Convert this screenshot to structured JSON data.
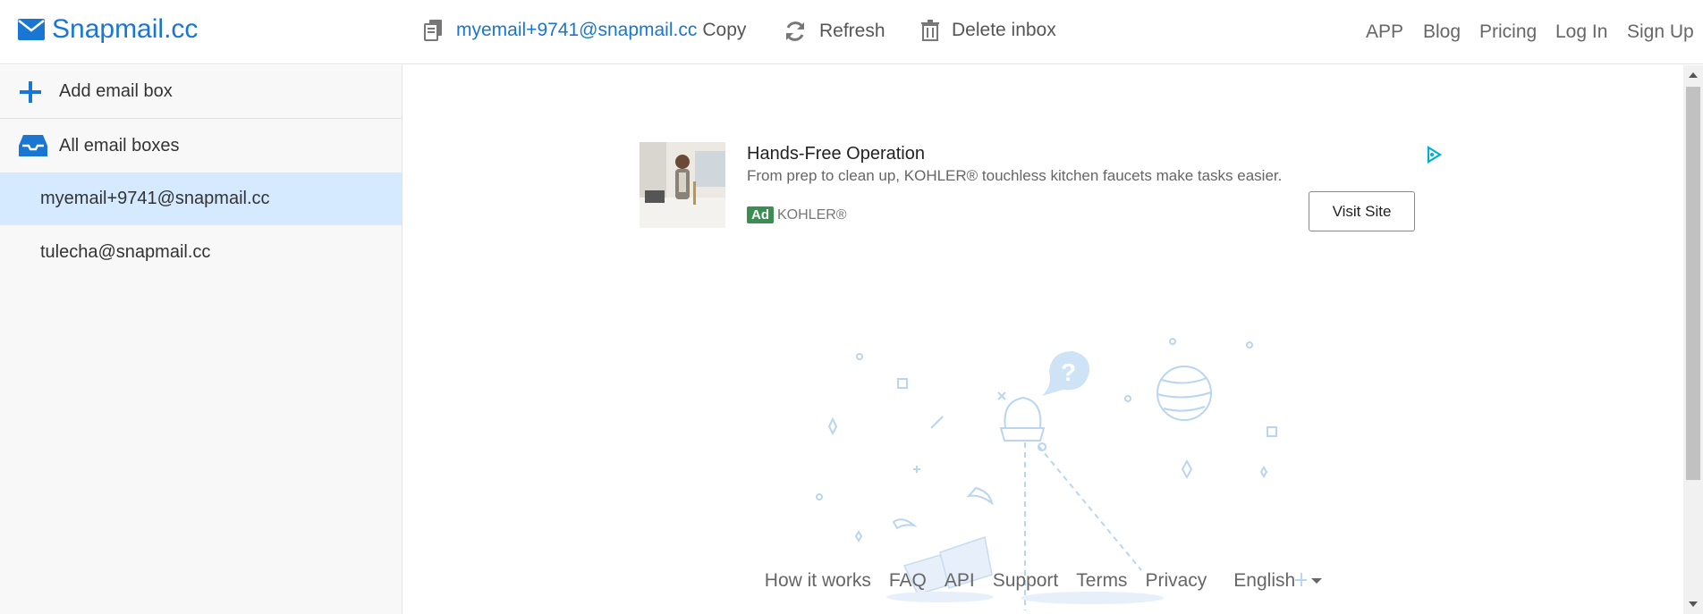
{
  "header": {
    "logo_text": "Snapmail.cc",
    "current_email": "myemail+9741@snapmail.cc",
    "copy_label": "Copy",
    "refresh_label": "Refresh",
    "delete_label": "Delete inbox",
    "nav": [
      "APP",
      "Blog",
      "Pricing",
      "Log In",
      "Sign Up"
    ]
  },
  "sidebar": {
    "add_label": "Add email box",
    "all_label": "All email boxes",
    "boxes": [
      "myemail+9741@snapmail.cc",
      "tulecha@snapmail.cc"
    ],
    "active_index": 0
  },
  "ad": {
    "title": "Hands-Free Operation",
    "description": "From prep to clean up, KOHLER® touchless kitchen faucets make tasks easier.",
    "badge": "Ad",
    "brand": "KOHLER®",
    "button": "Visit Site"
  },
  "footer": {
    "links": [
      "How it works",
      "FAQ",
      "API",
      "Support",
      "Terms",
      "Privacy"
    ],
    "language": "English"
  },
  "colors": {
    "accent": "#1976d2",
    "active_row": "#d6eaff",
    "ad_badge": "#3a8e52"
  }
}
